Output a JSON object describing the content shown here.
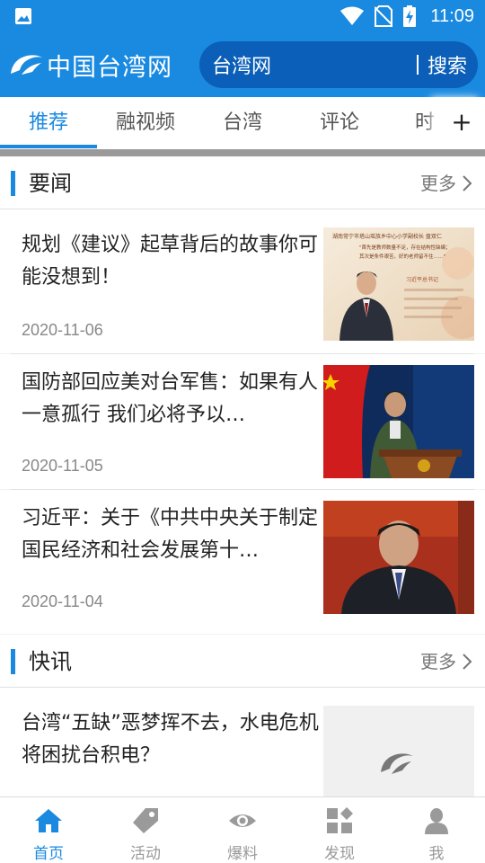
{
  "status_bar": {
    "time": "11:09"
  },
  "header": {
    "logo_text": "中国台湾网",
    "search_text": "台湾网",
    "search_button": "搜索"
  },
  "tabs": {
    "items": [
      "推荐",
      "融视频",
      "台湾",
      "评论",
      "时事"
    ],
    "active": "推荐",
    "add_label": "+"
  },
  "section_news": {
    "title": "要闻",
    "more": "更多",
    "items": [
      {
        "title": "规划《建议》起草背后的故事你可能没想到！",
        "date": "2020-11-06"
      },
      {
        "title": "国防部回应美对台军售：如果有人一意孤行 我们必将予以…",
        "date": "2020-11-05"
      },
      {
        "title": "习近平：关于《中共中央关于制定国民经济和社会发展第十…",
        "date": "2020-11-04"
      }
    ]
  },
  "section_flash": {
    "title": "快讯",
    "more": "更多",
    "items": [
      {
        "title": "台湾“五缺”恶梦挥不去，水电危机将困扰台积电？"
      }
    ]
  },
  "thumb_text": {
    "t1_line1": "湖南常宁市塔山瑶族乡中心小学副校长 盘双仁",
    "t1_line2": "\"首先是教师数量不足，存在结构性缺编；",
    "t1_line3": "其次是条件艰苦，好的老师留不住……\"",
    "t1_tag": "习近平总书记"
  },
  "bottom_nav": [
    {
      "label": "首页",
      "icon": "home-icon",
      "active": true
    },
    {
      "label": "活动",
      "icon": "tag-icon",
      "active": false
    },
    {
      "label": "爆料",
      "icon": "eye-icon",
      "active": false
    },
    {
      "label": "发现",
      "icon": "discover-icon",
      "active": false
    },
    {
      "label": "我",
      "icon": "user-icon",
      "active": false
    }
  ],
  "colors": {
    "primary": "#1a8ae0",
    "search_bg": "#0b5fb8",
    "inactive": "#9a9a9a"
  }
}
